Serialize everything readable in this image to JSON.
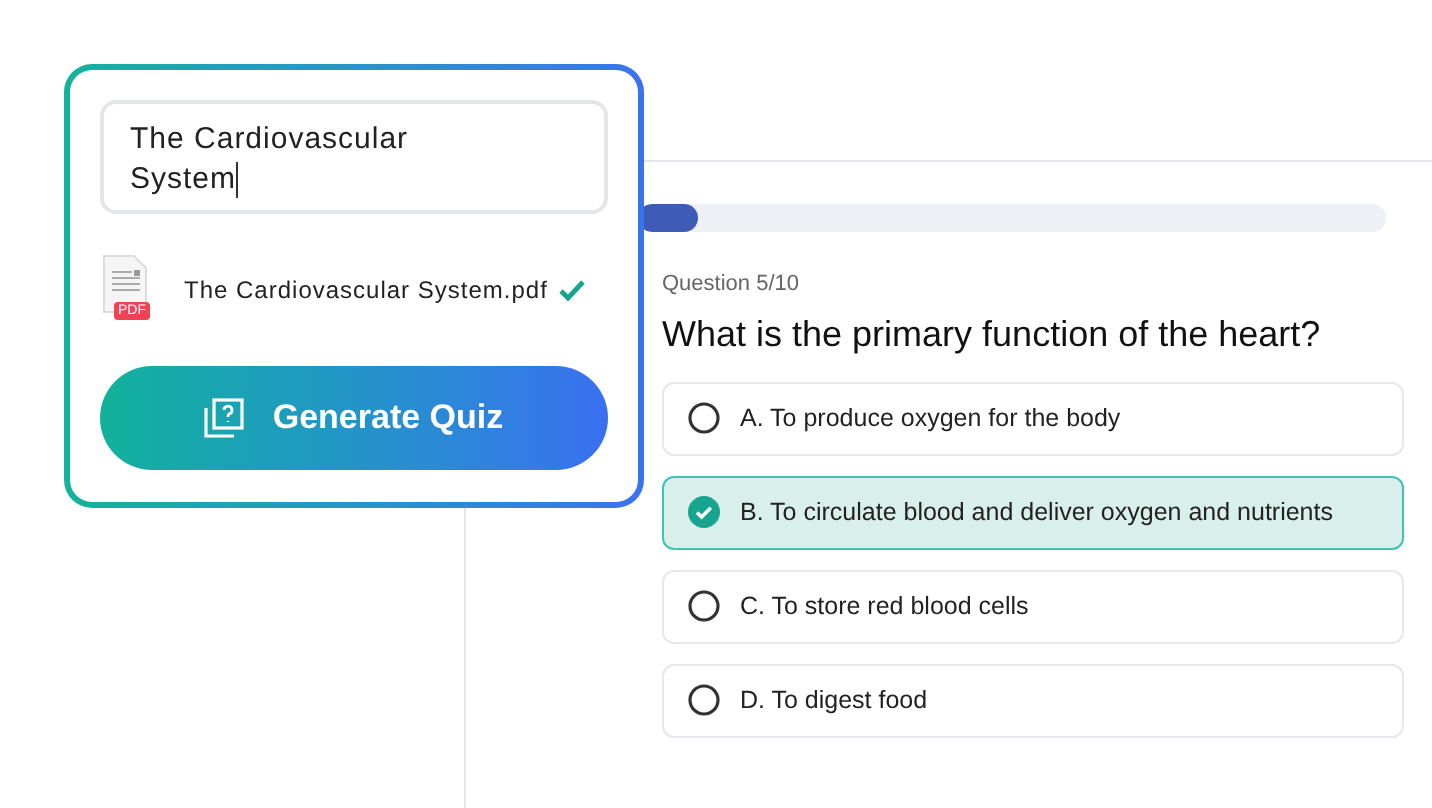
{
  "generator": {
    "title_value": "The Cardiovascular\nSystem",
    "file": {
      "badge": "PDF",
      "name": "The Cardiovascular System.pdf",
      "uploaded": true
    },
    "button": "Generate Quiz"
  },
  "quiz": {
    "progress": {
      "level": 0.08
    },
    "counter": "Question 5/10",
    "question": "What is the primary function of the heart?",
    "options": [
      {
        "label": "A. To produce oxygen for the body",
        "selected": false
      },
      {
        "label": "B. To circulate blood and deliver oxygen and nutrients",
        "selected": true
      },
      {
        "label": "C. To store red blood cells",
        "selected": false
      },
      {
        "label": "D. To digest food",
        "selected": false
      }
    ]
  }
}
